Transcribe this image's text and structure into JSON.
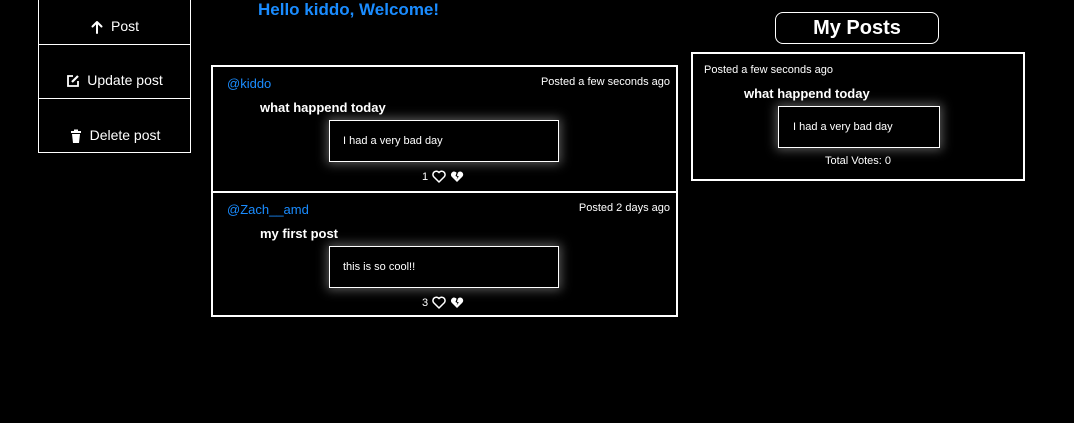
{
  "sidebar": {
    "items": [
      {
        "label": "Post",
        "icon": "arrow-up-icon"
      },
      {
        "label": "Update post",
        "icon": "edit-icon"
      },
      {
        "label": "Delete post",
        "icon": "trash-icon"
      }
    ]
  },
  "welcome": "Hello kiddo, Welcome!",
  "feed": {
    "posts": [
      {
        "user": "@kiddo",
        "time": "Posted a few seconds ago",
        "title": "what happend today",
        "body": "I had a very bad day",
        "votes": "1"
      },
      {
        "user": "@Zach__amd",
        "time": "Posted 2 days ago",
        "title": "my first post",
        "body": "this is so cool!!",
        "votes": "3"
      }
    ]
  },
  "my_posts": {
    "heading": "My Posts",
    "items": [
      {
        "time": "Posted a few seconds ago",
        "title": "what happend today",
        "body": "I had a very bad day",
        "total": "Total Votes: 0"
      }
    ]
  },
  "colors": {
    "accent": "#1a8cff",
    "background": "#000000",
    "foreground": "#ffffff"
  }
}
